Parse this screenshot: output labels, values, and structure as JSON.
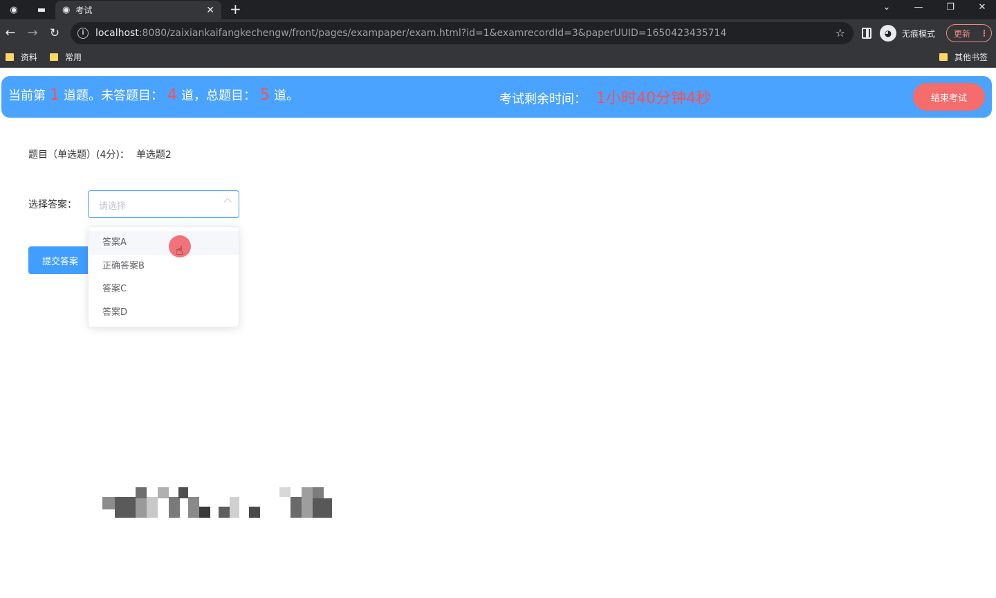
{
  "browser": {
    "tab_title": "考试",
    "url_host": "localhost",
    "url_rest": ":8080/zaixiankaifangkechengw/front/pages/exampaper/exam.html?id=1&examrecordId=3&paperUUID=1650423435714",
    "incognito_label": "无痕模式",
    "update_label": "更新",
    "bookmarks": [
      "资料",
      "常用"
    ],
    "other_bookmarks": "其他书签"
  },
  "status": {
    "prefix": "当前第",
    "current": "1",
    "unanswered_label": "道题。未答题目：",
    "unanswered": "4",
    "total_label": "道，总题目：",
    "total": "5",
    "suffix": "道。",
    "time_label": "考试剩余时间：",
    "time_left": "1小时40分钟4秒",
    "end_button": "结束考试"
  },
  "question": {
    "header": "题目（单选题）(4分)：",
    "text": "单选题2"
  },
  "answer": {
    "label": "选择答案：",
    "placeholder": "请选择",
    "options": [
      "答案A",
      "正确答案B",
      "答案C",
      "答案D"
    ]
  },
  "submit_button": "提交答案",
  "colors": {
    "status_bar": "#4aa3ff",
    "highlight_number": "#ff4d4f",
    "end_button": "#f56c6c",
    "primary": "#409eff"
  }
}
